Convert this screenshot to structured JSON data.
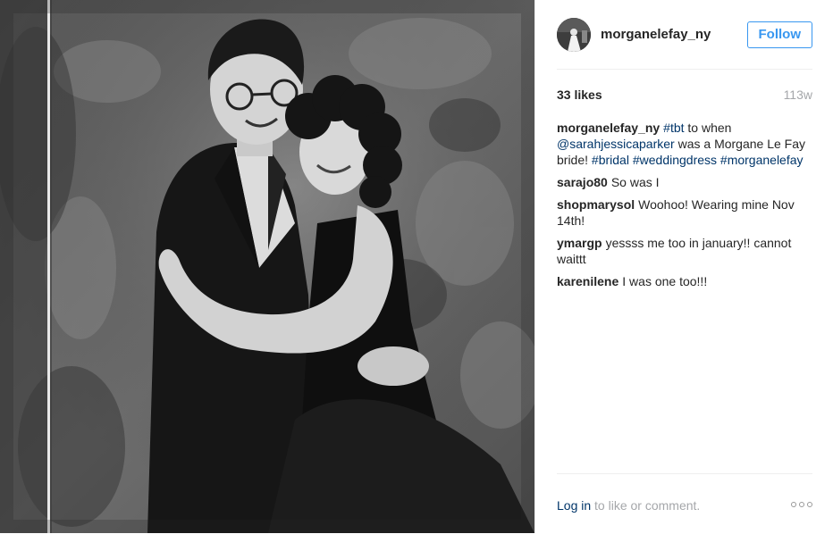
{
  "post": {
    "photo": {
      "alt": ""
    },
    "header": {
      "avatar_icon": "user-avatar-icon",
      "username": "morganelefay_ny",
      "follow_label": "Follow"
    },
    "meta": {
      "likes": "33 likes",
      "age": "113w"
    },
    "caption": {
      "author": "morganelefay_ny",
      "parts": [
        {
          "text": "#tbt",
          "link": true
        },
        {
          "text": " to when ",
          "link": false
        },
        {
          "text": "@sarahjessicaparker",
          "link": true
        },
        {
          "text": " was a Morgane Le Fay bride! ",
          "link": false
        },
        {
          "text": "#bridal",
          "link": true
        },
        {
          "text": " ",
          "link": false
        },
        {
          "text": "#weddingdress",
          "link": true
        },
        {
          "text": " ",
          "link": false
        },
        {
          "text": "#morganelefay",
          "link": true
        }
      ]
    },
    "comments": [
      {
        "author": "sarajo80",
        "text": "So was I"
      },
      {
        "author": "shopmarysol",
        "text": "Woohoo! Wearing mine Nov 14th!"
      },
      {
        "author": "ymargp",
        "text": "yessss me too in january!! cannot waittt"
      },
      {
        "author": "karenilene",
        "text": "I was one too!!!"
      }
    ],
    "footer": {
      "login_link": "Log in",
      "login_rest": " to like or comment.",
      "more_icon": "more-options-icon"
    },
    "colors": {
      "accent": "#3897f0",
      "link": "#003569",
      "muted": "#a5a7aa",
      "text": "#262626"
    }
  }
}
